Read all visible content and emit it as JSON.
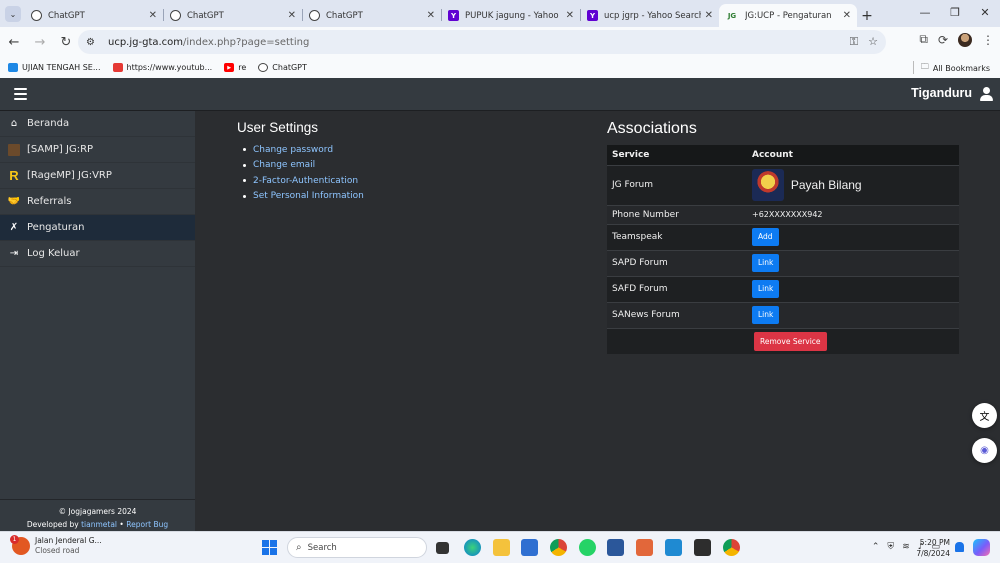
{
  "browser": {
    "tabs": [
      {
        "label": "ChatGPT",
        "favicon": "chatgpt-icon",
        "active": false
      },
      {
        "label": "ChatGPT",
        "favicon": "chatgpt-icon",
        "active": false
      },
      {
        "label": "ChatGPT",
        "favicon": "chatgpt-icon",
        "active": false
      },
      {
        "label": "PUPUK jagung - Yahoo Ima",
        "favicon": "yahoo-icon",
        "active": false
      },
      {
        "label": "ucp jgrp - Yahoo Search Re",
        "favicon": "yahoo-icon",
        "active": false
      },
      {
        "label": "JG:UCP - Pengaturan",
        "favicon": "jg-icon",
        "active": true
      }
    ],
    "jg_favicon_text": "JG",
    "url_host": "ucp.jg-gta.com",
    "url_path": "/index.php?page=setting",
    "bookmarks": [
      {
        "label": "UJIAN TENGAH SE...",
        "color": "#1e88e5"
      },
      {
        "label": "https://www.youtub...",
        "color": "#e53935"
      },
      {
        "label": "re",
        "color": "#ff0000"
      },
      {
        "label": "ChatGPT",
        "color": "#444444"
      }
    ],
    "all_bookmarks": "All Bookmarks"
  },
  "app": {
    "username": "Tiganduru",
    "nav": [
      {
        "label": "Beranda",
        "icon": "home-icon",
        "active": false
      },
      {
        "label": "[SAMP] JG:RP",
        "icon": "samp-icon",
        "active": false
      },
      {
        "label": "[RageMP] JG:VRP",
        "icon": "ragemp-icon",
        "active": false
      },
      {
        "label": "Referrals",
        "icon": "handshake-icon",
        "active": false
      },
      {
        "label": "Pengaturan",
        "icon": "tools-icon",
        "active": true
      },
      {
        "label": "Log Keluar",
        "icon": "sign-out-icon",
        "active": false
      }
    ],
    "ragemp_glyph": "R",
    "footer": {
      "copyright": "© Jogjagamers 2024",
      "developed_by": "Developed by",
      "dev_name": "tianmetal",
      "separator": "•",
      "report_bug": "Report Bug"
    },
    "settings": {
      "title": "User Settings",
      "links": [
        "Change password",
        "Change email",
        "2-Factor-Authentication",
        "Set Personal Information"
      ]
    },
    "associations": {
      "title": "Associations",
      "headers": {
        "service": "Service",
        "account": "Account"
      },
      "rows": [
        {
          "service": "JG Forum",
          "account": "Payah Bilang"
        },
        {
          "service": "Phone Number",
          "account": "+62XXXXXXX942"
        },
        {
          "service": "Teamspeak",
          "button": "Add"
        },
        {
          "service": "SAPD Forum",
          "button": "Link"
        },
        {
          "service": "SAFD Forum",
          "button": "Link"
        },
        {
          "service": "SANews Forum",
          "button": "Link"
        }
      ],
      "remove_button": "Remove Service"
    },
    "colors": {
      "link": "#8ec5ff",
      "primary_button": "#0d7bf2",
      "danger_button": "#dc3545",
      "active_nav": "#1e2b3a"
    }
  },
  "taskbar": {
    "weather_title": "Jalan Jenderal G...",
    "weather_sub": "Closed road",
    "weather_badge": "1",
    "search_placeholder": "Search",
    "time": "5:20 PM",
    "date": "7/8/2024"
  }
}
